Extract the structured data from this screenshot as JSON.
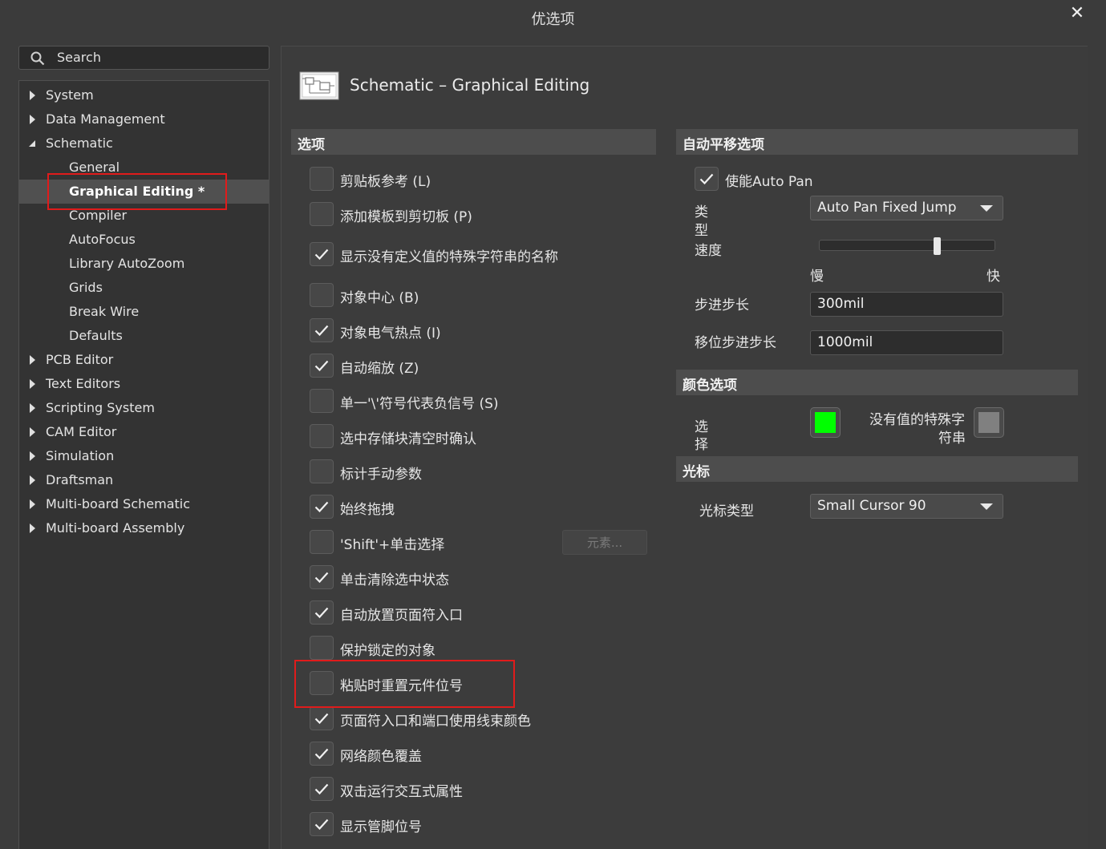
{
  "window": {
    "title": "优选项",
    "close_glyph": "✕"
  },
  "search": {
    "placeholder": "Search"
  },
  "tree": {
    "items": [
      {
        "label": "System",
        "expandable": true,
        "expanded": false
      },
      {
        "label": "Data Management",
        "expandable": true,
        "expanded": false
      },
      {
        "label": "Schematic",
        "expandable": true,
        "expanded": true
      },
      {
        "label": "General",
        "child": true
      },
      {
        "label": "Graphical Editing *",
        "child": true,
        "selected": true
      },
      {
        "label": "Compiler",
        "child": true
      },
      {
        "label": "AutoFocus",
        "child": true
      },
      {
        "label": "Library AutoZoom",
        "child": true
      },
      {
        "label": "Grids",
        "child": true
      },
      {
        "label": "Break Wire",
        "child": true
      },
      {
        "label": "Defaults",
        "child": true
      },
      {
        "label": "PCB Editor",
        "expandable": true,
        "expanded": false
      },
      {
        "label": "Text Editors",
        "expandable": true,
        "expanded": false
      },
      {
        "label": "Scripting System",
        "expandable": true,
        "expanded": false
      },
      {
        "label": "CAM Editor",
        "expandable": true,
        "expanded": false
      },
      {
        "label": "Simulation",
        "expandable": true,
        "expanded": false
      },
      {
        "label": "Draftsman",
        "expandable": true,
        "expanded": false
      },
      {
        "label": "Multi-board Schematic",
        "expandable": true,
        "expanded": false
      },
      {
        "label": "Multi-board Assembly",
        "expandable": true,
        "expanded": false
      }
    ]
  },
  "page": {
    "title": "Schematic – Graphical Editing"
  },
  "options": {
    "section_title": "选项",
    "items": [
      {
        "label": "剪贴板参考 (L)",
        "checked": false
      },
      {
        "label": "添加模板到剪切板 (P)",
        "checked": false
      },
      {
        "label": "显示没有定义值的特殊字符串的名称",
        "checked": true
      },
      {
        "label": "对象中心 (B)",
        "checked": false
      },
      {
        "label": "对象电气热点 (I)",
        "checked": true
      },
      {
        "label": "自动缩放 (Z)",
        "checked": true
      },
      {
        "label": "单一'\\'符号代表负信号 (S)",
        "checked": false
      },
      {
        "label": "选中存储块清空时确认",
        "checked": false
      },
      {
        "label": "标计手动参数",
        "checked": false
      },
      {
        "label": "始终拖拽",
        "checked": true
      },
      {
        "label": "'Shift'+单击选择",
        "checked": false
      },
      {
        "label": "单击清除选中状态",
        "checked": true
      },
      {
        "label": "自动放置页面符入口",
        "checked": true
      },
      {
        "label": "保护锁定的对象",
        "checked": false
      },
      {
        "label": "粘贴时重置元件位号",
        "checked": false
      },
      {
        "label": "页面符入口和端口使用线束颜色",
        "checked": true
      },
      {
        "label": "网络颜色覆盖",
        "checked": true
      },
      {
        "label": "双击运行交互式属性",
        "checked": true
      },
      {
        "label": "显示管脚位号",
        "checked": true
      }
    ],
    "elements_button": "元素..."
  },
  "autopan": {
    "section_title": "自动平移选项",
    "enable_label": "使能Auto Pan",
    "enable_checked": true,
    "type_label_1": "类",
    "type_label_2": "型",
    "type_value": "Auto Pan Fixed Jump",
    "speed_label": "速度",
    "speed_level": 0.68,
    "slow_label": "慢",
    "fast_label": "快",
    "step_label": "步进步长",
    "step_value": "300mil",
    "shift_step_label": "移位步进步长",
    "shift_step_value": "1000mil"
  },
  "colors": {
    "section_title": "颜色选项",
    "select_label_1": "选",
    "select_label_2": "择",
    "select_color": "#00ff00",
    "special_label_1": "没有值的特殊字",
    "special_label_2": "符串",
    "special_color": "#808080"
  },
  "cursor": {
    "section_title": "光标",
    "type_label": "光标类型",
    "type_value": "Small Cursor 90"
  },
  "theme": {
    "highlight": "#e01b1b",
    "background": "#3b3b3b"
  }
}
